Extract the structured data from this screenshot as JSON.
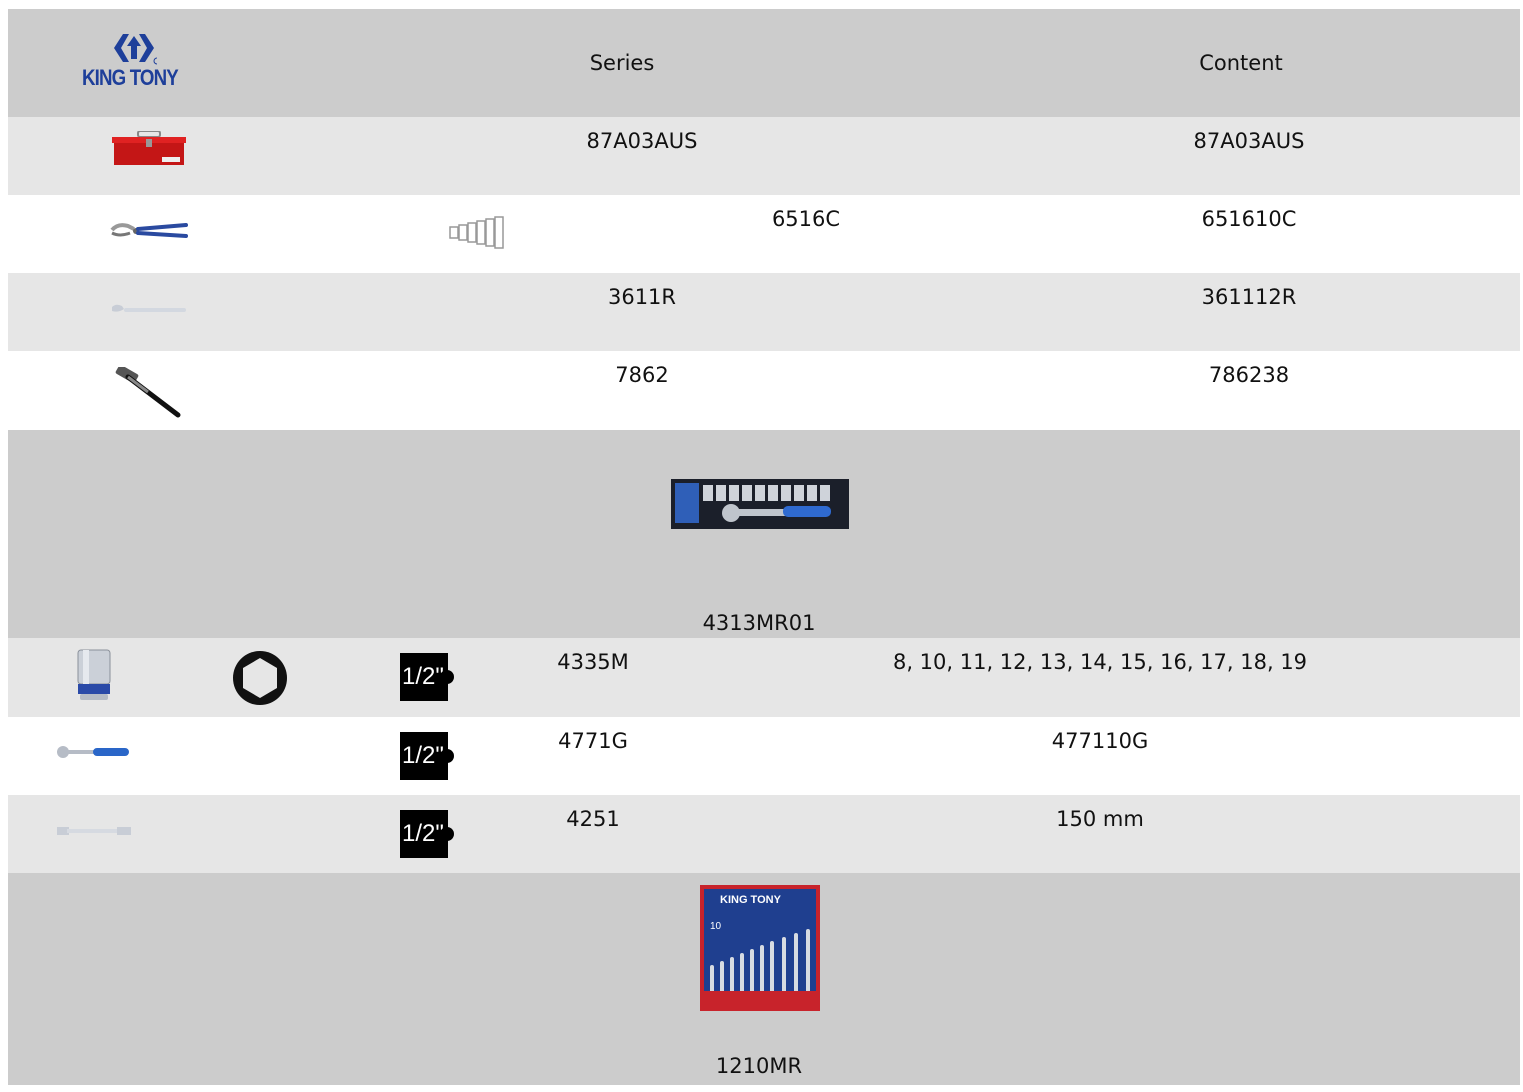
{
  "header": {
    "logo_text": "KING TONY",
    "col_series": "Series",
    "col_content": "Content"
  },
  "rows": [
    {
      "series": "87A03AUS",
      "content": "87A03AUS",
      "icon": "toolbox-icon"
    },
    {
      "series": "6516C",
      "content": "651610C",
      "icon": "pliers-icon",
      "extra_icon": "size-steps-icon"
    },
    {
      "series": "3611R",
      "content": "361112R",
      "icon": "adjustable-wrench-icon"
    },
    {
      "series": "7862",
      "content": "786238",
      "icon": "hammer-icon"
    }
  ],
  "socket_set": {
    "title": "4313MR01",
    "rows": [
      {
        "series": "4335M",
        "content": "8, 10, 11, 12, 13, 14, 15, 16, 17, 18, 19",
        "drive": "1/2\"",
        "icon": "socket-icon",
        "hex_icon": "hex-6pt-icon"
      },
      {
        "series": "4771G",
        "content": "477110G",
        "drive": "1/2\"",
        "icon": "ratchet-icon"
      },
      {
        "series": "4251",
        "content": "150 mm",
        "drive": "1/2\"",
        "icon": "extension-bar-icon"
      }
    ]
  },
  "wrench_set": {
    "title": "1210MR",
    "pack_brand": "KING TONY",
    "pack_count": "10"
  },
  "colors": {
    "dark_row": "#cccccc",
    "light_row": "#e6e6e6",
    "brand_blue": "#1e3f9a",
    "toolbox_red": "#d01a1a"
  }
}
